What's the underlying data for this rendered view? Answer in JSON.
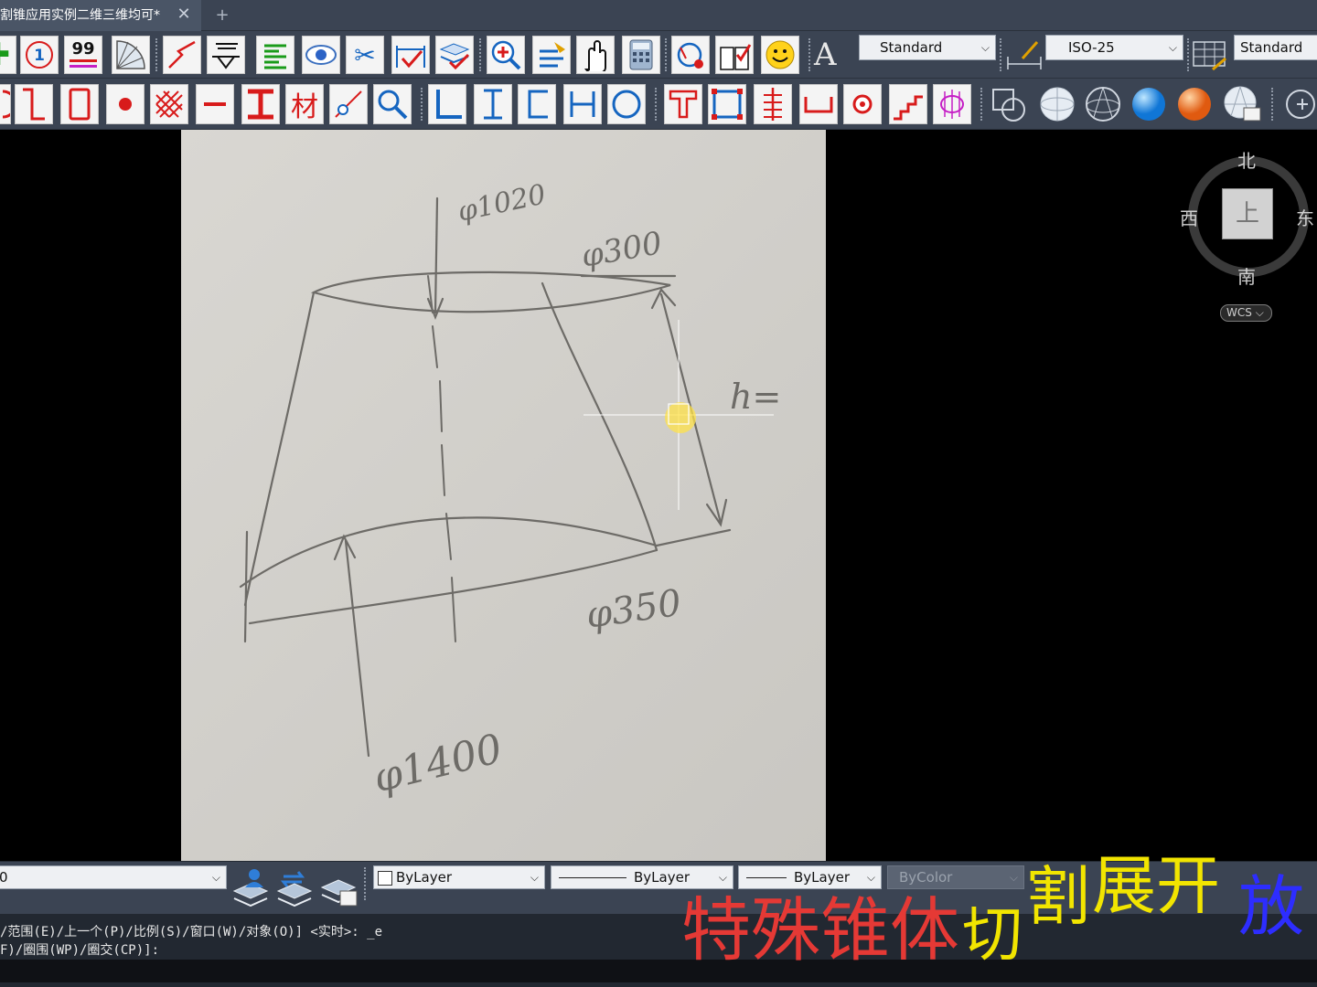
{
  "tab": {
    "title": "割锥应用实例二维三维均可*",
    "close": "✕",
    "add": "+"
  },
  "toolbar1": {
    "text_style": "Standard",
    "dim_style": "ISO-25",
    "table_style": "Standard",
    "icon_labels": [
      "99"
    ]
  },
  "toolbar2": {
    "char_材": "材"
  },
  "viewcube": {
    "north": "北",
    "south": "南",
    "west": "西",
    "east": "东",
    "face": "上",
    "wcs": "WCS"
  },
  "properties": {
    "layer": "0",
    "color": "ByLayer",
    "linetype": "ByLayer",
    "lineweight": "ByLayer",
    "plotstyle": "ByColor"
  },
  "command": {
    "line1": "/范围(E)/上一个(P)/比例(S)/窗口(W)/对象(O)] <实时>: _e",
    "line2": "F)/圈围(WP)/圈交(CP)]:"
  },
  "caption": {
    "part1": "特殊锥体",
    "part2": "切",
    "part3": "割",
    "part4": "展开",
    "part5": "放",
    "colors": {
      "red": "#e53935",
      "yellow": "#f2e500",
      "blue": "#2d2dff"
    }
  },
  "sketch": {
    "top_dia": "φ1020",
    "top_small": "φ300",
    "bottom_small": "φ350",
    "bottom_dia": "φ1400",
    "height": "h="
  }
}
